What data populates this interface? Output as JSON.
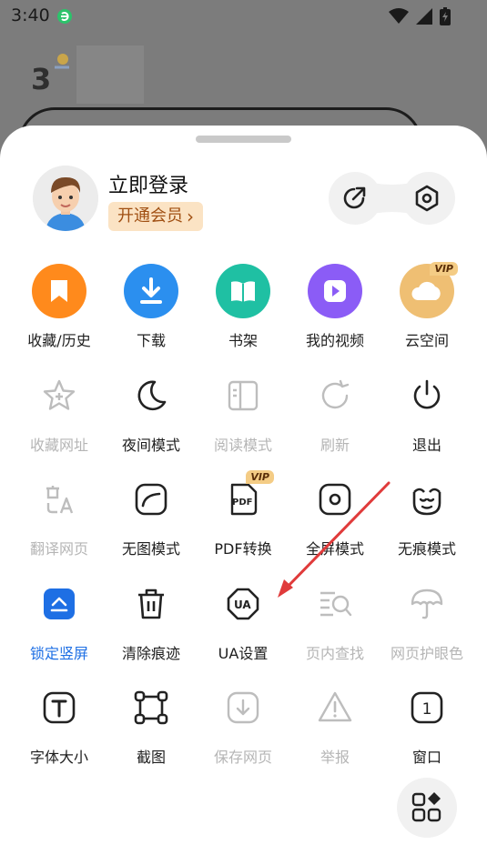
{
  "status": {
    "time": "3:40"
  },
  "background": {
    "temperature": "3"
  },
  "account": {
    "login_label": "立即登录",
    "vip_label": "开通会员"
  },
  "rows": [
    [
      {
        "label": "收藏/历史",
        "icon": "bookmark-icon",
        "state": "primary"
      },
      {
        "label": "下载",
        "icon": "download-icon",
        "state": "primary"
      },
      {
        "label": "书架",
        "icon": "bookshelf-icon",
        "state": "primary"
      },
      {
        "label": "我的视频",
        "icon": "video-icon",
        "state": "primary"
      },
      {
        "label": "云空间",
        "icon": "cloud-icon",
        "state": "primary",
        "badge": "VIP"
      }
    ],
    [
      {
        "label": "收藏网址",
        "icon": "star-add-icon",
        "state": "disabled"
      },
      {
        "label": "夜间模式",
        "icon": "moon-icon",
        "state": "normal"
      },
      {
        "label": "阅读模式",
        "icon": "reader-icon",
        "state": "disabled"
      },
      {
        "label": "刷新",
        "icon": "refresh-icon",
        "state": "disabled"
      },
      {
        "label": "退出",
        "icon": "power-icon",
        "state": "normal"
      }
    ],
    [
      {
        "label": "翻译网页",
        "icon": "translate-icon",
        "state": "disabled"
      },
      {
        "label": "无图模式",
        "icon": "no-image-icon",
        "state": "normal"
      },
      {
        "label": "PDF转换",
        "icon": "pdf-icon",
        "state": "normal",
        "badge": "VIP"
      },
      {
        "label": "全屏模式",
        "icon": "fullscreen-icon",
        "state": "normal"
      },
      {
        "label": "无痕模式",
        "icon": "incognito-icon",
        "state": "normal"
      }
    ],
    [
      {
        "label": "锁定竖屏",
        "icon": "lock-portrait-icon",
        "state": "active"
      },
      {
        "label": "清除痕迹",
        "icon": "trash-icon",
        "state": "normal"
      },
      {
        "label": "UA设置",
        "icon": "ua-icon",
        "state": "normal"
      },
      {
        "label": "页内查找",
        "icon": "find-in-page-icon",
        "state": "disabled"
      },
      {
        "label": "网页护眼色",
        "icon": "umbrella-icon",
        "state": "disabled"
      }
    ],
    [
      {
        "label": "字体大小",
        "icon": "font-size-icon",
        "state": "normal"
      },
      {
        "label": "截图",
        "icon": "screenshot-icon",
        "state": "normal"
      },
      {
        "label": "保存网页",
        "icon": "save-page-icon",
        "state": "disabled"
      },
      {
        "label": "举报",
        "icon": "report-icon",
        "state": "disabled"
      },
      {
        "label": "窗口",
        "icon": "window-icon",
        "state": "normal",
        "window_count": "1"
      }
    ]
  ],
  "colors": {
    "blue": "#1e6fe4",
    "orange": "#ff8a1c",
    "download_blue": "#2b8fef",
    "teal": "#1fc0a3",
    "purple": "#8b5cf6",
    "gold": "#f1c27d",
    "annotation_red": "#e03b3b"
  }
}
